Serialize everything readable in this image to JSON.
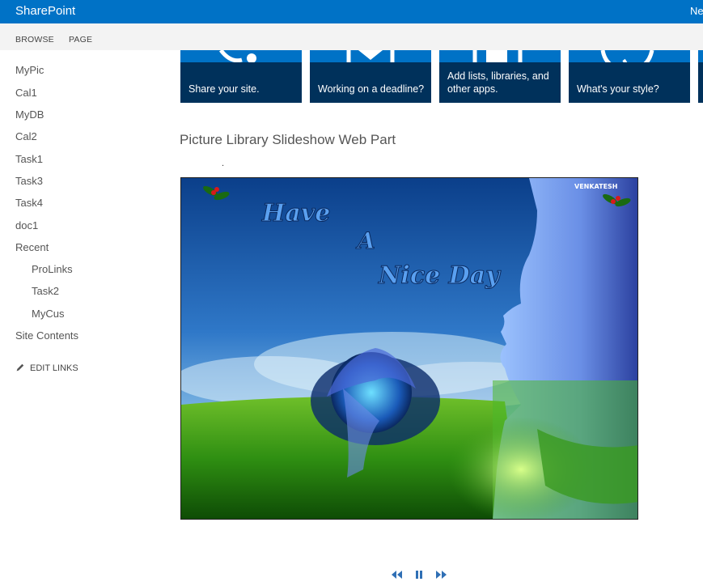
{
  "suitebar": {
    "brand": "SharePoint",
    "right_link": "Ne",
    "background": "#0072c6"
  },
  "ribbon": {
    "tabs": [
      {
        "label": "BROWSE"
      },
      {
        "label": "PAGE"
      }
    ]
  },
  "leftnav": {
    "items": [
      {
        "label": "MyPic"
      },
      {
        "label": "Cal1"
      },
      {
        "label": "MyDB"
      },
      {
        "label": "Cal2"
      },
      {
        "label": "Task1"
      },
      {
        "label": "Task3"
      },
      {
        "label": "Task4"
      },
      {
        "label": "doc1"
      },
      {
        "label": "Recent"
      },
      {
        "label": "ProLinks"
      },
      {
        "label": "Task2"
      },
      {
        "label": "MyCus"
      },
      {
        "label": "Site Contents"
      }
    ],
    "edit_links": "EDIT LINKS",
    "edit_icon": "pencil-icon"
  },
  "tiles": [
    {
      "label": "Share your site.",
      "icon": "share-icon"
    },
    {
      "label": "Working on a deadline?",
      "icon": "calendar-icon"
    },
    {
      "label": "Add lists, libraries, and other apps.",
      "icon": "apps-icon"
    },
    {
      "label": "What's your style?",
      "icon": "style-icon"
    }
  ],
  "webpart": {
    "title": "Picture Library Slideshow Web Part",
    "dot": ".",
    "image": {
      "line1": "Have",
      "line2": "A",
      "line3": "Nice Day",
      "watermark": "VENKATESH"
    },
    "controls": [
      {
        "icon": "previous-icon"
      },
      {
        "icon": "pause-icon"
      },
      {
        "icon": "next-icon"
      }
    ]
  },
  "colors": {
    "tile_band": "#00315b",
    "tile_top": "#0072c6",
    "ribbon_bg": "#f3f3f3",
    "control_blue": "#2f6fb5"
  }
}
